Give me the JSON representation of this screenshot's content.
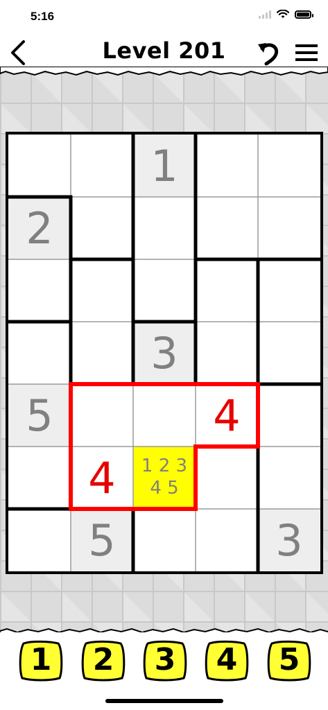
{
  "status": {
    "time": "5:16"
  },
  "header": {
    "title": "Level 201",
    "back_icon": "chevron-left-icon",
    "undo_icon": "undo-icon",
    "menu_icon": "hamburger-menu-icon"
  },
  "colors": {
    "selected_cell": "#ffff00",
    "hint_cell": "#eeeeee",
    "hint_text": "#808080",
    "error_text": "#e60000",
    "error_outline": "#ff0000",
    "digit_button": "#ffff33"
  },
  "board": {
    "rows": 7,
    "cols": 5,
    "cells": [
      [
        "",
        "",
        "1",
        "",
        ""
      ],
      [
        "2",
        "",
        "",
        "",
        ""
      ],
      [
        "",
        "",
        "",
        "",
        ""
      ],
      [
        "",
        "",
        "3",
        "",
        ""
      ],
      [
        "5",
        "",
        "",
        "4",
        ""
      ],
      [
        "",
        "4",
        "",
        "",
        ""
      ],
      [
        "",
        "5",
        "",
        "",
        "3"
      ]
    ],
    "cell_types": [
      [
        "empty",
        "empty",
        "given",
        "empty",
        "empty"
      ],
      [
        "given",
        "empty",
        "empty",
        "empty",
        "empty"
      ],
      [
        "empty",
        "empty",
        "empty",
        "empty",
        "empty"
      ],
      [
        "empty",
        "empty",
        "given",
        "empty",
        "empty"
      ],
      [
        "given",
        "empty",
        "empty",
        "error",
        "empty"
      ],
      [
        "empty",
        "error",
        "selected",
        "empty",
        "empty"
      ],
      [
        "empty",
        "given",
        "empty",
        "empty",
        "given"
      ]
    ],
    "regions": [
      [
        0,
        0,
        1,
        2,
        2
      ],
      [
        3,
        0,
        1,
        2,
        2
      ],
      [
        3,
        4,
        1,
        5,
        6
      ],
      [
        7,
        4,
        8,
        5,
        6
      ],
      [
        7,
        9,
        9,
        9,
        10
      ],
      [
        7,
        9,
        9,
        11,
        10
      ],
      [
        12,
        12,
        11,
        11,
        10
      ]
    ],
    "selected_cell": {
      "row": 5,
      "col": 2,
      "candidates": "1 2 3\n4 5"
    },
    "error_region_row_col": [
      [
        4,
        1
      ],
      [
        4,
        2
      ],
      [
        4,
        3
      ],
      [
        5,
        1
      ],
      [
        5,
        2
      ]
    ]
  },
  "digits": [
    "1",
    "2",
    "3",
    "4",
    "5"
  ]
}
